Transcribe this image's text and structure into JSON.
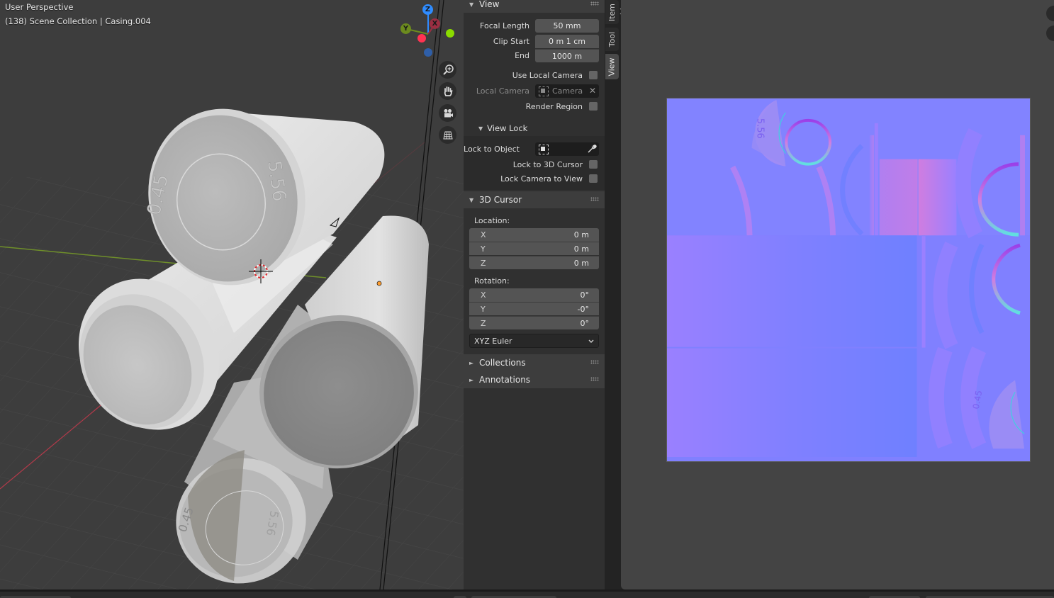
{
  "viewport": {
    "perspective_label": "User Perspective",
    "collection_label": "(138) Scene Collection | Casing.004",
    "gizmo": {
      "z_label": "Z",
      "y_label": "Y",
      "x_label": "X",
      "colors": {
        "z": "#2f8cff",
        "y": "#6c8b1e",
        "x": "#9b2e42",
        "neg_x": "#ff3352",
        "neg_y": "#8bdc00",
        "neg_z": "#2f5fa8"
      }
    },
    "nav_buttons": [
      {
        "name": "zoom-icon"
      },
      {
        "name": "pan-hand-icon"
      },
      {
        "name": "camera-view-icon"
      },
      {
        "name": "ortho-grid-icon"
      }
    ],
    "casing_stamp_text": [
      "0.45",
      "5.56"
    ],
    "background_color": "#3d3d3d"
  },
  "sidebar": {
    "tabs": [
      {
        "label": "Item",
        "active": false
      },
      {
        "label": "Tool",
        "active": false
      },
      {
        "label": "View",
        "active": true
      }
    ],
    "view_panel": {
      "title": "View",
      "focal_length": {
        "label": "Focal Length",
        "value": "50 mm"
      },
      "clip_start": {
        "label": "Clip Start",
        "value": "0 m 1 cm"
      },
      "clip_end": {
        "label": "End",
        "value": "1000 m"
      },
      "use_local_camera": {
        "label": "Use Local Camera",
        "checked": false
      },
      "local_camera": {
        "label": "Local Camera",
        "value": "Camera"
      },
      "render_region": {
        "label": "Render Region",
        "checked": false
      },
      "view_lock": {
        "title": "View Lock",
        "lock_to_object": {
          "label": "Lock to Object",
          "value": ""
        },
        "lock_to_3d_cursor": {
          "label": "Lock to 3D Cursor",
          "checked": false
        },
        "lock_camera_to_view": {
          "label": "Lock Camera to View",
          "checked": false
        }
      }
    },
    "cursor_panel": {
      "title": "3D Cursor",
      "location_label": "Location:",
      "location": [
        {
          "axis": "X",
          "value": "0 m"
        },
        {
          "axis": "Y",
          "value": "0 m"
        },
        {
          "axis": "Z",
          "value": "0 m"
        }
      ],
      "rotation_label": "Rotation:",
      "rotation": [
        {
          "axis": "X",
          "value": "0°"
        },
        {
          "axis": "Y",
          "value": "-0°"
        },
        {
          "axis": "Z",
          "value": "0°"
        }
      ],
      "rotation_mode": "XYZ Euler"
    },
    "collapsed_panels": [
      {
        "title": "Collections"
      },
      {
        "title": "Annotations"
      }
    ]
  },
  "image_editor": {
    "texture_type": "normal map",
    "base_color": "#8080ff"
  }
}
